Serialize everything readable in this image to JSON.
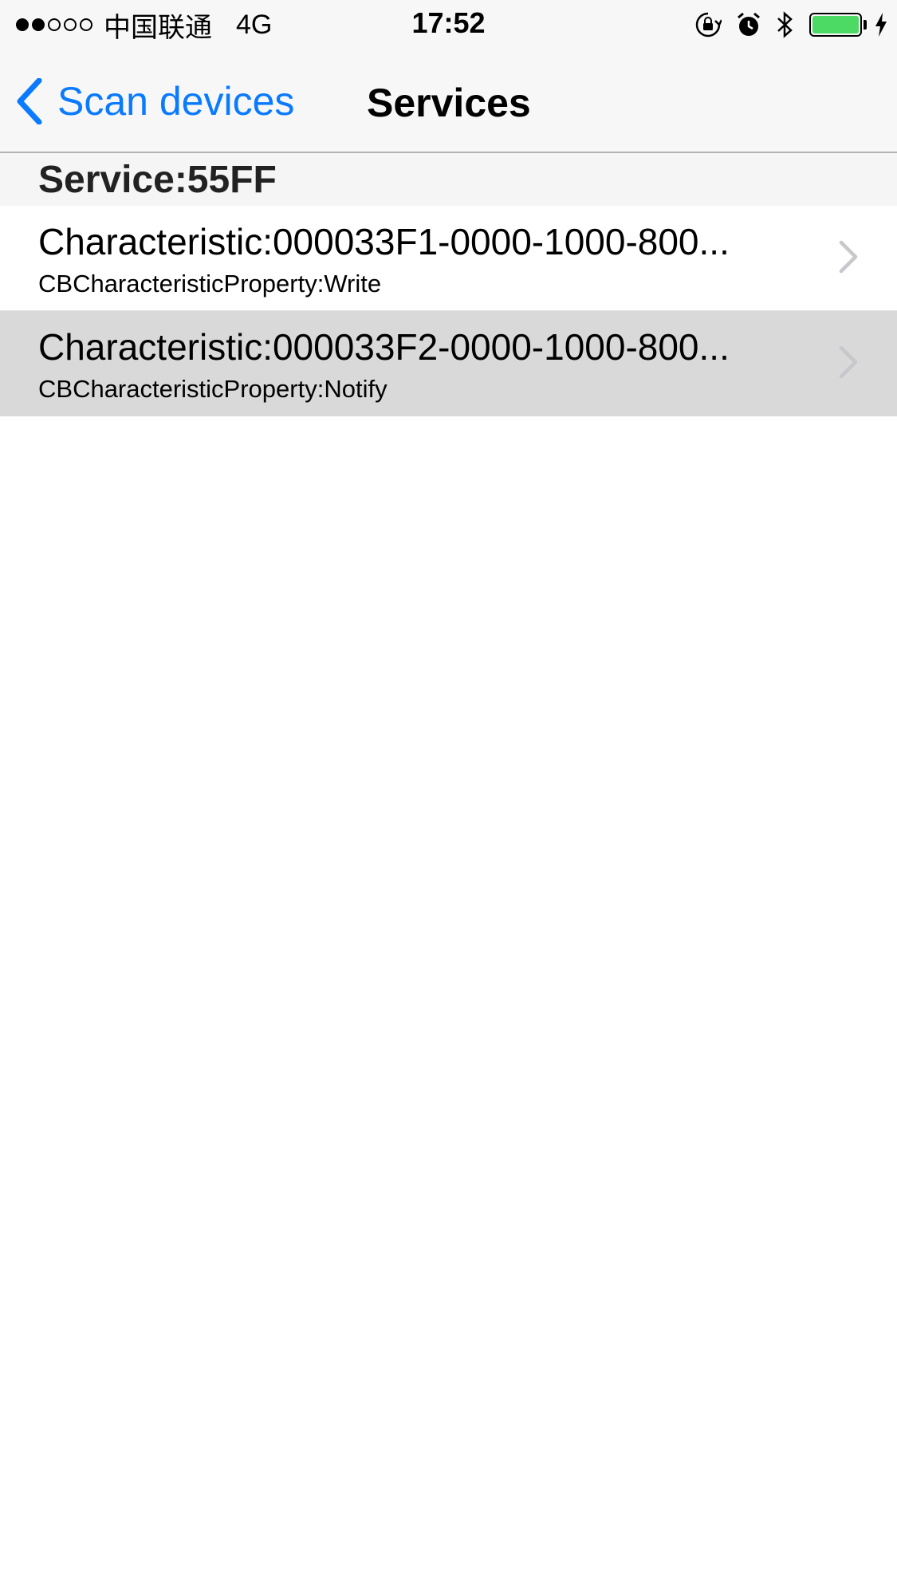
{
  "status_bar": {
    "signal_filled": 2,
    "signal_total": 5,
    "carrier": "中国联通",
    "network": "4G",
    "time": "17:52",
    "icons": [
      "rotation-lock-icon",
      "alarm-icon",
      "bluetooth-icon",
      "battery-icon",
      "charging-icon"
    ],
    "battery_level": 1.0,
    "battery_color": "#4cd964"
  },
  "nav": {
    "back_label": "Scan devices",
    "title": "Services",
    "accent_color": "#0a7aff"
  },
  "section": {
    "header": "Service:55FF"
  },
  "rows": [
    {
      "title": "Characteristic:000033F1-0000-1000-800...",
      "subtitle": "CBCharacteristicProperty:Write",
      "highlighted": false
    },
    {
      "title": "Characteristic:000033F2-0000-1000-800...",
      "subtitle": "CBCharacteristicProperty:Notify",
      "highlighted": true
    }
  ]
}
